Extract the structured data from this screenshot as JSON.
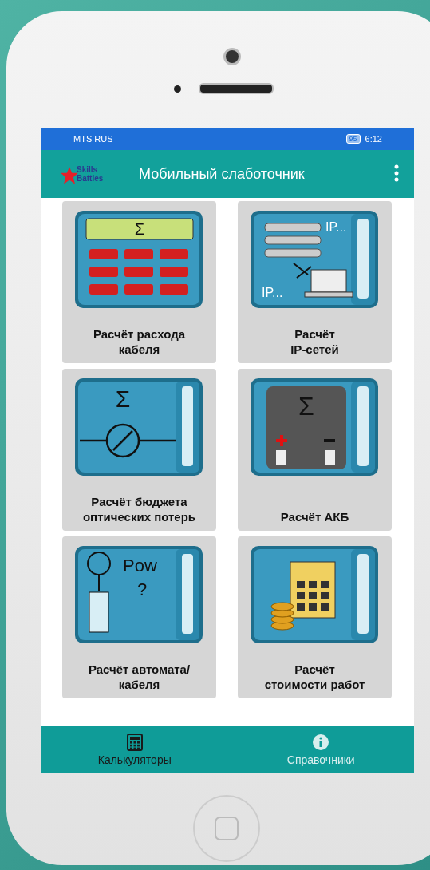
{
  "status_bar": {
    "carrier": "MTS RUS",
    "battery": "95",
    "time": "6:12"
  },
  "app_bar": {
    "logo_top": "Skills",
    "logo_bottom": "Battles",
    "title": "Мобильный слаботочник"
  },
  "tiles": [
    {
      "kind": "cable",
      "label": "Расчёт расхода\nкабеля",
      "art_texts": [
        "Σ"
      ]
    },
    {
      "kind": "ip",
      "label": "Расчёт\nIP-сетей",
      "art_texts": [
        "IP...",
        "IP..."
      ]
    },
    {
      "kind": "optics",
      "label": "Расчёт бюджета\nоптических потерь",
      "art_texts": [
        "Σ"
      ]
    },
    {
      "kind": "battery",
      "label": "Расчёт АКБ",
      "art_texts": [
        "Σ"
      ]
    },
    {
      "kind": "breaker",
      "label": "Расчёт автомата/\nкабеля",
      "art_texts": [
        "Pow",
        "?"
      ]
    },
    {
      "kind": "cost",
      "label": "Расчёт\nстоимости работ"
    }
  ],
  "bottom_nav": [
    {
      "kind": "calculator",
      "label": "Калькуляторы",
      "selected": true
    },
    {
      "kind": "info",
      "label": "Справочники",
      "selected": false
    }
  ]
}
